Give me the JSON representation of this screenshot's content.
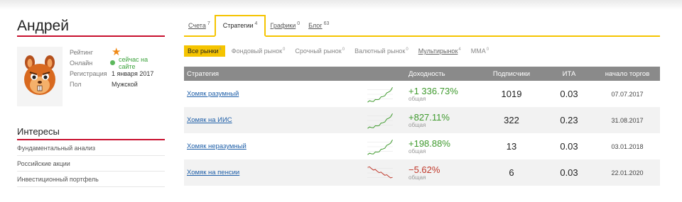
{
  "profile": {
    "name": "Андрей",
    "fields": [
      {
        "label": "Рейтинг",
        "value": "",
        "icon": "star-icon"
      },
      {
        "label": "Онлайн",
        "value": "сейчас на сайте",
        "icon": "online-dot-icon"
      },
      {
        "label": "Регистрация",
        "value": "1 января 2017"
      },
      {
        "label": "Пол",
        "value": "Мужской"
      }
    ]
  },
  "interests": {
    "title": "Интересы",
    "items": [
      "Фундаментальный анализ",
      "Российские акции",
      "Инвестиционный портфель"
    ]
  },
  "tabs": [
    {
      "label": "Счета",
      "count": "7"
    },
    {
      "label": "Стратегии",
      "count": "4",
      "active": true
    },
    {
      "label": "Графики",
      "count": "0"
    },
    {
      "label": "Блог",
      "count": "63"
    }
  ],
  "filters": [
    {
      "label": "Все рынки",
      "count": "4",
      "active": true
    },
    {
      "label": "Фондовый рынок",
      "count": "0"
    },
    {
      "label": "Срочный рынок",
      "count": "0"
    },
    {
      "label": "Валютный рынок",
      "count": "0"
    },
    {
      "label": "Мультирынок",
      "count": "4",
      "linked": true
    },
    {
      "label": "ММА",
      "count": "0"
    }
  ],
  "table": {
    "headers": [
      "Стратегия",
      "Доходность",
      "Подписчики",
      "ИТА",
      "начало торгов"
    ],
    "rows": [
      {
        "name": "Хомяк разумный",
        "yield": "+1 336.73%",
        "yield_label": "общая",
        "trend": "up",
        "subscribers": "1019",
        "ita": "0.03",
        "start": "07.07.2017"
      },
      {
        "name": "Хомяк на ИИС",
        "yield": "+827.11%",
        "yield_label": "общая",
        "trend": "up",
        "subscribers": "322",
        "ita": "0.23",
        "start": "31.08.2017"
      },
      {
        "name": "Хомяк неразумный",
        "yield": "+198.88%",
        "yield_label": "общая",
        "trend": "up",
        "subscribers": "13",
        "ita": "0.03",
        "start": "03.01.2018"
      },
      {
        "name": "Хомяк на пенсии",
        "yield": "−5.62%",
        "yield_label": "общая",
        "trend": "down",
        "subscribers": "6",
        "ita": "0.03",
        "start": "22.01.2020"
      }
    ]
  },
  "colors": {
    "accent_red": "#c8102e",
    "accent_yellow": "#f5c400",
    "positive": "#3f9a2e",
    "negative": "#c0392b",
    "link": "#1f5fa8"
  }
}
